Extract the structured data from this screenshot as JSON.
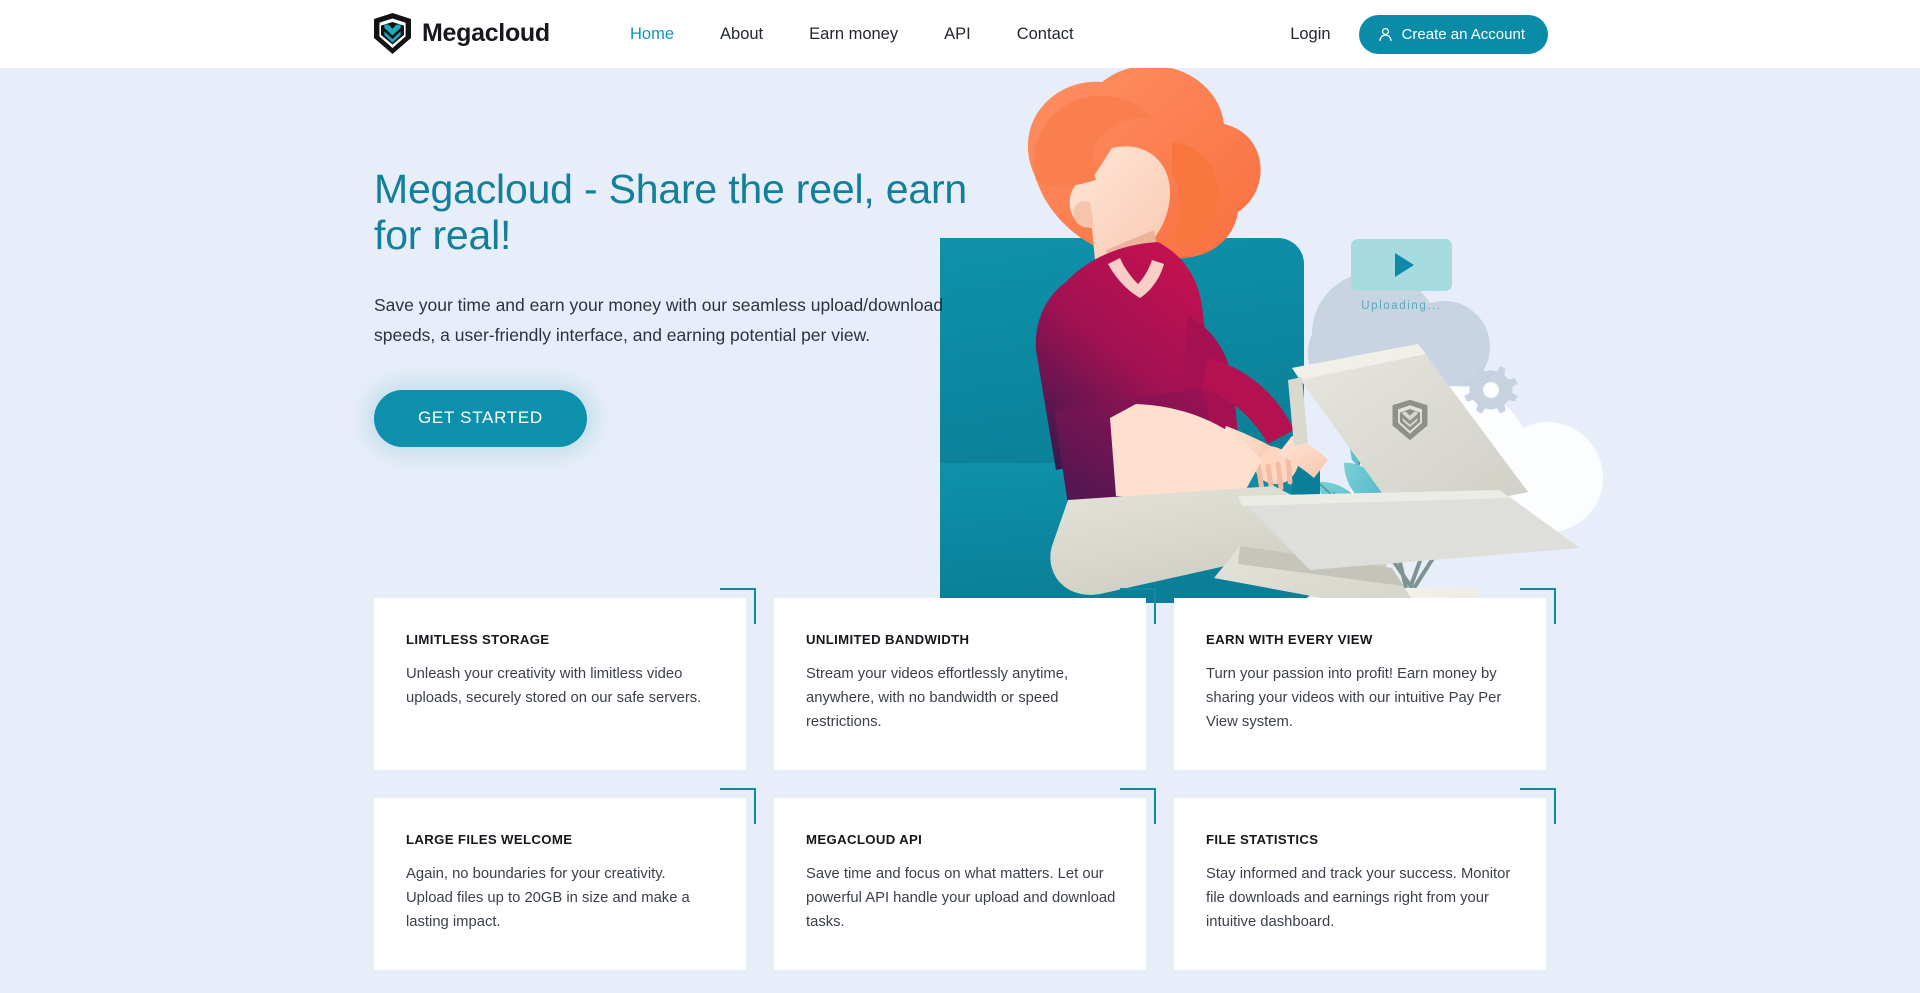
{
  "header": {
    "brand": {
      "name": "Megacloud",
      "logo_icon": "megacloud-shield-logo"
    },
    "nav": [
      {
        "label": "Home",
        "active": true
      },
      {
        "label": "About",
        "active": false
      },
      {
        "label": "Earn money",
        "active": false
      },
      {
        "label": "API",
        "active": false
      },
      {
        "label": "Contact",
        "active": false
      }
    ],
    "login_label": "Login",
    "create_account_label": "Create an Account",
    "create_account_icon": "user-icon"
  },
  "hero": {
    "title": "Megacloud - Share the reel, earn for real!",
    "subtitle": "Save your time and earn your money with our seamless upload/download speeds, a user-friendly interface, and earning potential per view.",
    "cta_label": "GET STARTED",
    "upload_badge": {
      "label": "Uploading...",
      "icon": "play-icon"
    },
    "illustration_elements": [
      "woman-on-couch-with-laptop",
      "cloud-with-gear-icon",
      "potted-plant"
    ]
  },
  "features": [
    {
      "title": "LIMITLESS STORAGE",
      "text": "Unleash your creativity with limitless video uploads, securely stored on our safe servers."
    },
    {
      "title": "UNLIMITED BANDWIDTH",
      "text": "Stream your videos effortlessly anytime, anywhere, with no bandwidth or speed restrictions."
    },
    {
      "title": "EARN WITH EVERY VIEW",
      "text": "Turn your passion into profit! Earn money by sharing your videos with our intuitive Pay Per View system."
    },
    {
      "title": "LARGE FILES WELCOME",
      "text": "Again, no boundaries for your creativity. Upload files up to 20GB in size and make a lasting impact."
    },
    {
      "title": "MEGACLOUD API",
      "text": "Save time and focus on what matters. Let our powerful API handle your upload and download tasks."
    },
    {
      "title": "FILE STATISTICS",
      "text": "Stay informed and track your success. Monitor file downloads and earnings right from your intuitive dashboard."
    }
  ],
  "colors": {
    "page_background": "#e8eef9",
    "header_background": "#ffffff",
    "accent_teal": "#0d90ab",
    "heading_teal": "#128099",
    "nav_active": "#0e97b5",
    "card_background": "#ffffff",
    "card_corner": "#0d8ca5",
    "couch_teal": "#0d8ea8",
    "couch_navy": "#0d3f63",
    "hair_orange": "#fb8051",
    "sweater_crimson": "#c2104f",
    "sweater_purple": "#3b1c52",
    "plant_leaf": "#58bfc9",
    "text_dark": "#2d323c"
  }
}
